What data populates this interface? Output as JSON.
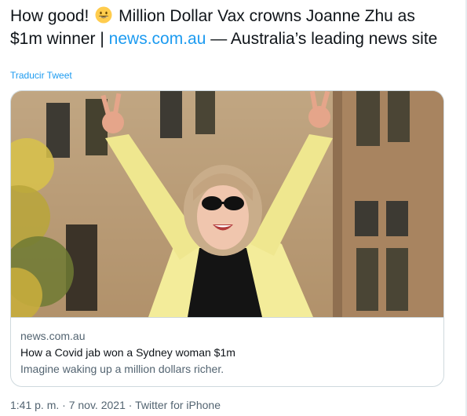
{
  "tweet": {
    "text_part1": "How good!",
    "emoji": "grinning-face-emoji",
    "text_part2": " Million Dollar Vax crowns Joanne Zhu as $1m winner | ",
    "link": "news.com.au",
    "text_part3": " — Australia’s leading news site",
    "translate_label": "Traducir Tweet"
  },
  "card": {
    "image": "woman-celebrating-photo",
    "domain": "news.com.au",
    "title": "How a Covid jab won a Sydney woman $1m",
    "description": "Imagine waking up a million dollars richer."
  },
  "meta": {
    "time": "1:41 p. m.",
    "separator": " · ",
    "date": "7 nov. 2021",
    "source": "Twitter for iPhone"
  }
}
